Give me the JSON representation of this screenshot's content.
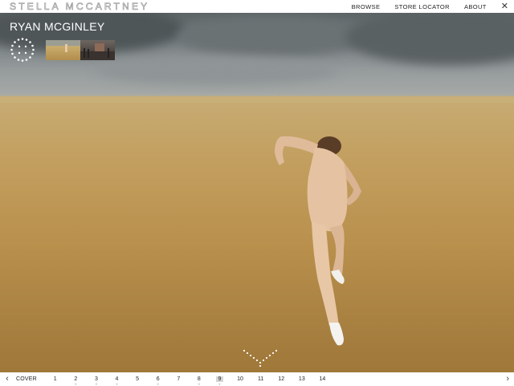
{
  "brand": {
    "logo_text": "STELLA McCARTNEY"
  },
  "nav": {
    "items": [
      "BROWSE",
      "STORE LOCATOR",
      "ABOUT"
    ],
    "close_icon": "close-icon"
  },
  "gallery": {
    "artist": "RYAN MCGINLEY",
    "grid_icon": "dots-circle-icon",
    "scroll_icon": "chevron-down-icon"
  },
  "pager": {
    "prev_icon": "chevron-left-icon",
    "cover_label": "COVER",
    "pages": [
      "1",
      "2",
      "3",
      "4",
      "5",
      "6",
      "7",
      "8",
      "9",
      "10",
      "11",
      "12",
      "13",
      "14"
    ],
    "pages_with_sub": [
      "2",
      "3",
      "4",
      "6",
      "8",
      "9"
    ],
    "active_page": "9",
    "next_icon": "chevron-right-icon"
  },
  "colors": {
    "accent_active": "#d6d6d6",
    "text": "#222222"
  }
}
